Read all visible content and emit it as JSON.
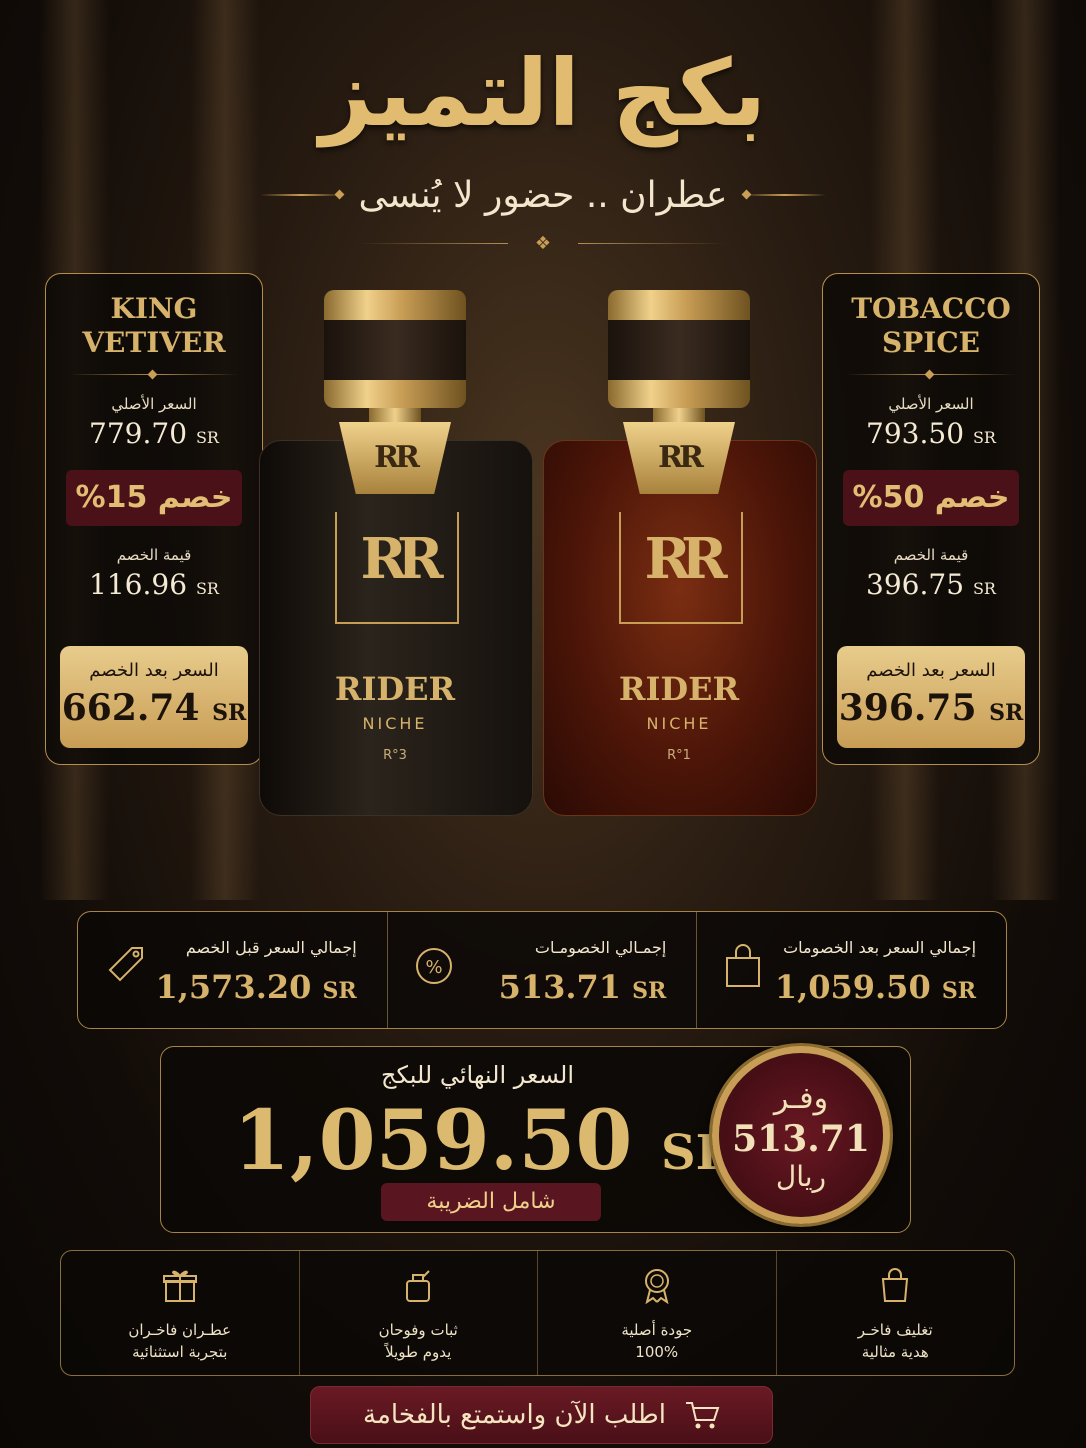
{
  "header": {
    "title": "بكج التميز",
    "subtitle": "عطران .. حضور لا يُنسى"
  },
  "products": {
    "left": {
      "name_line1": "KING",
      "name_line2": "VETIVER",
      "original_label": "السعر الأصلي",
      "original_value": "779.70",
      "discount": "خصم 15%",
      "discount_amount_label": "قيمة الخصم",
      "discount_amount": "116.96",
      "final_label": "السعر بعد الخصم",
      "final_value": "662.74",
      "currency": "SR"
    },
    "right": {
      "name_line1": "TOBACCO",
      "name_line2": "SPICE",
      "original_label": "السعر الأصلي",
      "original_value": "793.50",
      "discount": "خصم 50%",
      "discount_amount_label": "قيمة الخصم",
      "discount_amount": "396.75",
      "final_label": "السعر بعد الخصم",
      "final_value": "396.75",
      "currency": "SR"
    }
  },
  "bottles": {
    "black": {
      "monogram": "RR",
      "brand": "RIDER",
      "line": "NICHE",
      "number": "R°3"
    },
    "amber": {
      "monogram": "RR",
      "brand": "RIDER",
      "line": "NICHE",
      "number": "R°1"
    }
  },
  "summary": {
    "before_label": "إجمالي السعر قبل الخصم",
    "before_value": "1,573.20",
    "discounts_label": "إجمـالي الخصومـات",
    "discounts_value": "513.71",
    "after_label": "إجمالي السعر بعد الخصومات",
    "after_value": "1,059.50",
    "currency": "SR"
  },
  "final": {
    "label": "السعر النهائي للبكج",
    "value": "1,059.50",
    "currency": "SR",
    "tax_note": "شامل الضريبة",
    "save_label": "وفـر",
    "save_value": "513.71",
    "save_currency": "ريال"
  },
  "features": [
    {
      "line1": "عطـران فاخـران",
      "line2": "بتجربة استثنائية",
      "icon": "gift-icon"
    },
    {
      "line1": "ثبات وفوحان",
      "line2": "يدوم طويلاً",
      "icon": "perfume-bottle-icon"
    },
    {
      "line1": "جودة أصلية",
      "line2": "100%",
      "icon": "quality-badge-icon"
    },
    {
      "line1": "تغليف فاخـر",
      "line2": "هدية مثالية",
      "icon": "shopping-bag-icon"
    }
  ],
  "cta": {
    "label": "اطلب الآن واستمتع بالفخامة",
    "icon": "cart-icon"
  },
  "colors": {
    "gold": "#d9b46a",
    "burgundy": "#4a0f17",
    "background": "#120c08"
  }
}
